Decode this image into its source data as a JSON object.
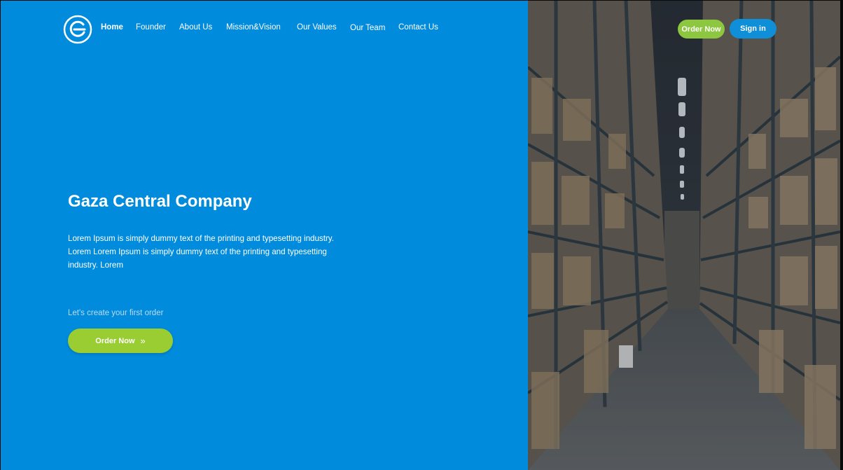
{
  "brand": {
    "logo_icon": "g-circle-logo-icon",
    "primary_color": "#008bdc",
    "accent_color": "#8dc63f"
  },
  "nav": {
    "items": [
      {
        "label": "Home",
        "active": true
      },
      {
        "label": "Founder",
        "active": false
      },
      {
        "label": "About Us",
        "active": false
      },
      {
        "label": "Mission&Vision",
        "active": false
      },
      {
        "label": "Our Values",
        "active": false
      },
      {
        "label": "Our Team",
        "active": false
      },
      {
        "label": "Contact Us",
        "active": false
      }
    ],
    "order_now_label": "Order Now",
    "sign_in_label": "Sign in"
  },
  "hero": {
    "title": "Gaza Central Company",
    "description": "Lorem Ipsum is simply dummy text of the printing and typesetting industry. Lorem Lorem Ipsum is simply dummy text of the printing and typesetting industry. Lorem",
    "cta_label": "Let's create your first order",
    "cta_button": "Order Now",
    "cta_button_icon": "double-chevron-right-icon"
  },
  "image": {
    "subject": "warehouse-aisle-photo"
  }
}
